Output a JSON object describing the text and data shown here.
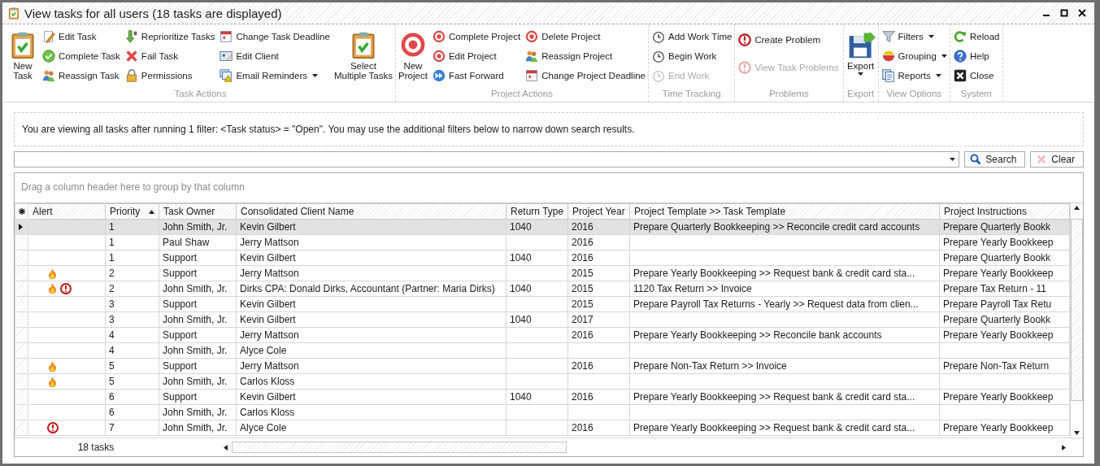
{
  "window": {
    "title": "View tasks for all users (18 tasks are displayed)"
  },
  "ribbon": {
    "groups": [
      {
        "label": "Task Actions",
        "columns": [
          {
            "kind": "large",
            "items": [
              {
                "label": "New Task",
                "disabled": false,
                "dropdown": false
              }
            ]
          },
          {
            "kind": "stack",
            "items": [
              {
                "label": "Edit Task",
                "disabled": false,
                "dropdown": false
              },
              {
                "label": "Complete Task",
                "disabled": false,
                "dropdown": false
              },
              {
                "label": "Reassign Task",
                "disabled": false,
                "dropdown": false
              }
            ]
          },
          {
            "kind": "stack",
            "items": [
              {
                "label": "Reprioritize Tasks",
                "disabled": false,
                "dropdown": false
              },
              {
                "label": "Fail Task",
                "disabled": false,
                "dropdown": false
              },
              {
                "label": "Permissions",
                "disabled": false,
                "dropdown": false
              }
            ]
          },
          {
            "kind": "stack",
            "items": [
              {
                "label": "Change Task Deadline",
                "disabled": false,
                "dropdown": false
              },
              {
                "label": "Edit Client",
                "disabled": false,
                "dropdown": false
              },
              {
                "label": "Email Reminders",
                "disabled": false,
                "dropdown": true
              }
            ]
          },
          {
            "kind": "large",
            "items": [
              {
                "label": "Select Multiple Tasks",
                "disabled": false,
                "dropdown": false
              }
            ]
          }
        ]
      },
      {
        "label": "Project Actions",
        "columns": [
          {
            "kind": "large",
            "items": [
              {
                "label": "New Project",
                "disabled": false,
                "dropdown": false
              }
            ]
          },
          {
            "kind": "stack",
            "items": [
              {
                "label": "Complete Project",
                "disabled": false,
                "dropdown": false
              },
              {
                "label": "Edit Project",
                "disabled": false,
                "dropdown": false
              },
              {
                "label": "Fast Forward",
                "disabled": false,
                "dropdown": false
              }
            ]
          },
          {
            "kind": "stack",
            "items": [
              {
                "label": "Delete Project",
                "disabled": false,
                "dropdown": false
              },
              {
                "label": "Reassign Project",
                "disabled": false,
                "dropdown": false
              },
              {
                "label": "Change Project Deadline",
                "disabled": false,
                "dropdown": false
              }
            ]
          }
        ]
      },
      {
        "label": "Time Tracking",
        "columns": [
          {
            "kind": "stack",
            "items": [
              {
                "label": "Add Work Time",
                "disabled": false,
                "dropdown": false
              },
              {
                "label": "Begin Work",
                "disabled": false,
                "dropdown": false
              },
              {
                "label": "End Work",
                "disabled": true,
                "dropdown": false
              }
            ]
          }
        ]
      },
      {
        "label": "Problems",
        "columns": [
          {
            "kind": "spread",
            "items": [
              {
                "label": "Create Problem",
                "disabled": false,
                "dropdown": false
              },
              {
                "label": "View Task Problems",
                "disabled": true,
                "dropdown": false
              }
            ]
          }
        ]
      },
      {
        "label": "Export",
        "columns": [
          {
            "kind": "large",
            "items": [
              {
                "label": "Export",
                "disabled": false,
                "dropdown": true
              }
            ]
          }
        ]
      },
      {
        "label": "View Options",
        "columns": [
          {
            "kind": "stack",
            "items": [
              {
                "label": "Filters",
                "disabled": false,
                "dropdown": true
              },
              {
                "label": "Grouping",
                "disabled": false,
                "dropdown": true
              },
              {
                "label": "Reports",
                "disabled": false,
                "dropdown": true
              }
            ]
          }
        ]
      },
      {
        "label": "System",
        "columns": [
          {
            "kind": "stack",
            "items": [
              {
                "label": "Reload",
                "disabled": false,
                "dropdown": false
              },
              {
                "label": "Help",
                "disabled": false,
                "dropdown": false
              },
              {
                "label": "Close",
                "disabled": false,
                "dropdown": false
              }
            ]
          }
        ]
      }
    ]
  },
  "filter_message": "You are viewing all tasks after running 1 filter: <Task status> = \"Open\". You may use the additional filters below to narrow down search results.",
  "search": {
    "search_button": "Search",
    "clear_button": "Clear",
    "clear_disabled": true
  },
  "grid": {
    "group_panel_hint": "Drag a column header here to group by that column",
    "columns": [
      {
        "label": "Alert",
        "sorted": false
      },
      {
        "label": "Priority",
        "sorted": true
      },
      {
        "label": "Task Owner",
        "sorted": false
      },
      {
        "label": "Consolidated Client Name",
        "sorted": false
      },
      {
        "label": "Return Type",
        "sorted": false
      },
      {
        "label": "Project Year",
        "sorted": false
      },
      {
        "label": "Project Template >> Task Template",
        "sorted": false
      },
      {
        "label": "Project Instructions",
        "sorted": false
      }
    ],
    "rows": [
      {
        "selected": true,
        "alerts": [],
        "priority": "1",
        "owner": "John Smith, Jr.",
        "client": "Kevin Gilbert",
        "return_type": "1040",
        "year": "2016",
        "template": "Prepare Quarterly Bookkeeping >> Reconcile credit card accounts",
        "instructions": "Prepare Quarterly Bookk"
      },
      {
        "selected": false,
        "alerts": [],
        "priority": "1",
        "owner": "Paul Shaw",
        "client": "Jerry Mattson",
        "year": "2016",
        "instructions": "Prepare Yearly Bookkeep"
      },
      {
        "selected": false,
        "alerts": [],
        "priority": "1",
        "owner": "Support",
        "client": "Kevin Gilbert",
        "return_type": "1040",
        "year": "2016",
        "instructions": "Prepare Quarterly Bookk"
      },
      {
        "selected": false,
        "alerts": [
          {
            "kind": "fire"
          }
        ],
        "priority": "2",
        "owner": "Support",
        "client": "Jerry Mattson",
        "year": "2015",
        "template": "Prepare Yearly Bookkeeping >> Request bank & credit card sta...",
        "instructions": "Prepare Yearly Bookkeep"
      },
      {
        "selected": false,
        "alerts": [
          {
            "kind": "fire"
          },
          {
            "kind": "problem"
          }
        ],
        "priority": "2",
        "owner": "John Smith, Jr.",
        "client": "Dirks CPA: Donald Dirks, Accountant (Partner: Maria Dirks)",
        "return_type": "1040",
        "year": "2015",
        "template": "1120 Tax Return >> Invoice",
        "instructions": "Prepare Tax Return - 11"
      },
      {
        "selected": false,
        "alerts": [],
        "priority": "3",
        "owner": "Support",
        "client": "Kevin Gilbert",
        "year": "2015",
        "template": "Prepare Payroll Tax Returns - Yearly >> Request data from clien...",
        "instructions": "Prepare Payroll Tax Retu"
      },
      {
        "selected": false,
        "alerts": [],
        "priority": "3",
        "owner": "John Smith, Jr.",
        "client": "Kevin Gilbert",
        "return_type": "1040",
        "year": "2017",
        "instructions": "Prepare Quarterly Bookk"
      },
      {
        "selected": false,
        "alerts": [],
        "priority": "4",
        "owner": "Support",
        "client": "Jerry Mattson",
        "year": "2016",
        "template": "Prepare Yearly Bookkeeping >> Reconcile bank accounts",
        "instructions": "Prepare Yearly Bookkeep"
      },
      {
        "selected": false,
        "alerts": [],
        "priority": "4",
        "owner": "John Smith, Jr.",
        "client": "Alyce Cole"
      },
      {
        "selected": false,
        "alerts": [
          {
            "kind": "fire"
          }
        ],
        "priority": "5",
        "owner": "Support",
        "client": "Jerry Mattson",
        "year": "2016",
        "template": "Prepare Non-Tax Return >> Invoice",
        "instructions": "Prepare Non-Tax Return"
      },
      {
        "selected": false,
        "alerts": [
          {
            "kind": "fire"
          }
        ],
        "priority": "5",
        "owner": "John Smith, Jr.",
        "client": "Carlos Kloss"
      },
      {
        "selected": false,
        "alerts": [],
        "priority": "6",
        "owner": "Support",
        "client": "Kevin Gilbert",
        "return_type": "1040",
        "year": "2016",
        "template": "Prepare Yearly Bookkeeping >> Request bank & credit card sta...",
        "instructions": "Prepare Yearly Bookkeep"
      },
      {
        "selected": false,
        "alerts": [],
        "priority": "6",
        "owner": "John Smith, Jr.",
        "client": "Carlos Kloss"
      },
      {
        "selected": false,
        "alerts": [
          {
            "kind": "problem"
          }
        ],
        "priority": "7",
        "owner": "John Smith, Jr.",
        "client": "Alyce Cole",
        "year": "2016",
        "template": "Prepare Yearly Bookkeeping >> Request bank & credit card sta...",
        "instructions": "Prepare Yearly Bookkeep"
      }
    ],
    "footer_count": "18 tasks"
  }
}
